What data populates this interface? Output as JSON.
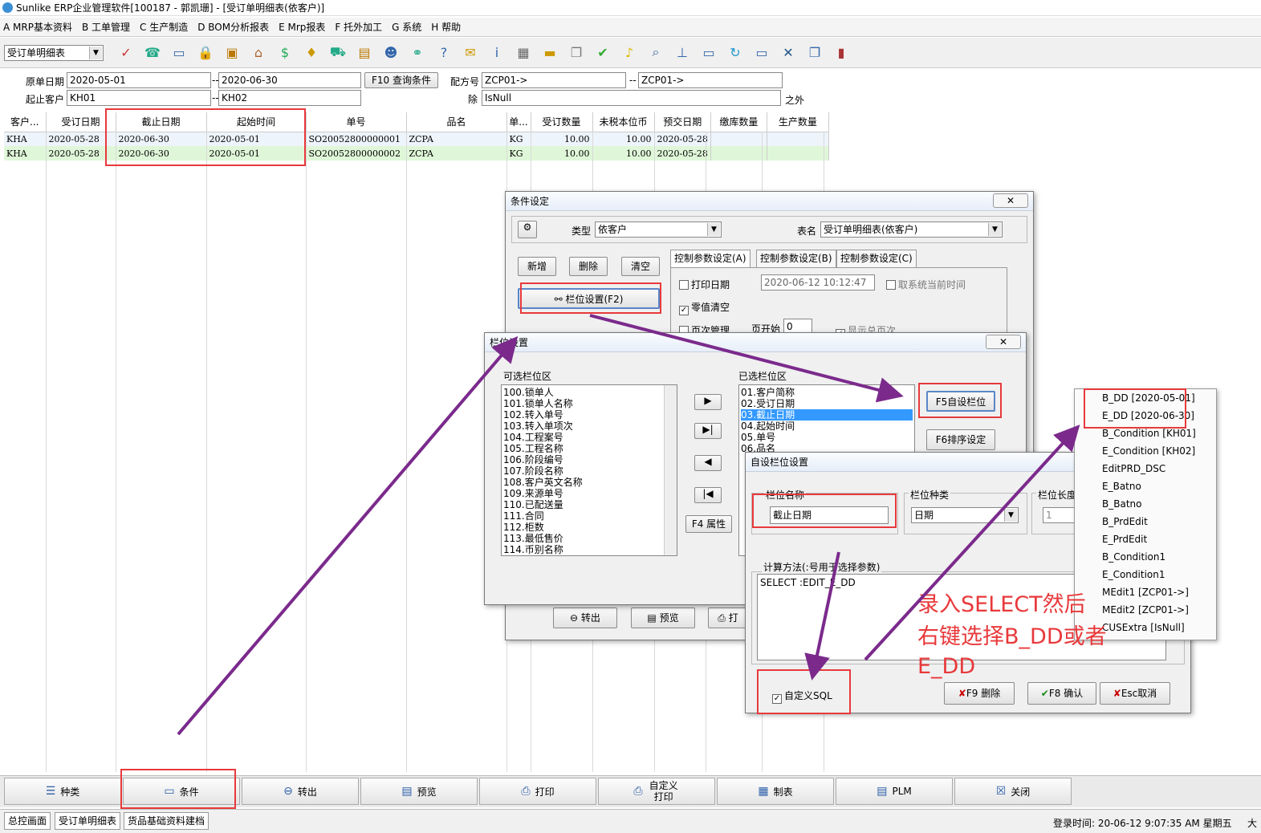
{
  "window": {
    "title": "Sunlike ERP企业管理软件[100187 - 郭凯珊] - [受订单明细表(依客户)]"
  },
  "menu": [
    "A MRP基本资料",
    "B 工单管理",
    "C 生产制造",
    "D BOM分析报表",
    "E Mrp报表",
    "F 托外加工",
    "G 系统",
    "H 帮助"
  ],
  "toolbar": {
    "report_select": "受订单明细表",
    "icons": [
      "spell-check-icon",
      "phone-icon",
      "monitor-icon",
      "lock-icon",
      "briefcase-icon",
      "house-icon",
      "dollar-icon",
      "money-bag-icon",
      "cart-icon",
      "clipboard-icon",
      "users-icon",
      "link-icon",
      "help-doc-icon",
      "mail-icon",
      "info-icon",
      "calculator-icon",
      "folder-icon",
      "copy-icon",
      "ok-icon",
      "bell-icon",
      "search-icon",
      "org-chart-icon",
      "screen-icon",
      "refresh-icon",
      "window-icon",
      "close-box-icon",
      "restore-icon",
      "exit-door-icon"
    ]
  },
  "filter": {
    "date_label": "原单日期",
    "date_from": "2020-05-01",
    "date_to": "2020-06-30",
    "query_button": "F10 查询条件",
    "formula_label": "配方号",
    "formula_from": "ZCP01->",
    "formula_to": "ZCP01->",
    "customer_label": "起止客户",
    "customer_from": "KH01",
    "customer_to": "KH02",
    "except_label": "除",
    "except_value": "IsNull",
    "except_suffix": "之外"
  },
  "grid": {
    "headers": [
      "客户...",
      "受订日期",
      "截止日期",
      "起始时间",
      "单号",
      "品名",
      "单...",
      "受订数量",
      "未税本位币",
      "预交日期",
      "缴库数量",
      "生产数量"
    ],
    "rows": [
      [
        "KHA",
        "2020-05-28",
        "2020-06-30",
        "2020-05-01",
        "SO20052800000001",
        "ZCPA",
        "KG",
        "10.00",
        "10.00",
        "2020-05-28",
        "",
        ""
      ],
      [
        "KHA",
        "2020-05-28",
        "2020-06-30",
        "2020-05-01",
        "SO20052800000002",
        "ZCPA",
        "KG",
        "10.00",
        "10.00",
        "2020-05-28",
        "",
        ""
      ]
    ]
  },
  "condition_dialog": {
    "title": "条件设定",
    "close": "✕",
    "type_label": "类型",
    "type_value": "依客户",
    "table_label": "表名",
    "table_value": "受订单明细表(依客户)",
    "add": "新增",
    "delete": "删除",
    "clear": "清空",
    "field_setting": "栏位设置(F2)",
    "tabs": [
      "控制参数设定(A)",
      "控制参数设定(B)",
      "控制参数设定(C)"
    ],
    "print_date_label": "打印日期",
    "print_date_value": "2020-06-12 10:12:47",
    "use_sys_time": "取系统当前时间",
    "zero_clear": "零值清空",
    "page_mgmt": "页次管理",
    "page_start_label": "页开始",
    "page_start_value": "0",
    "show_total_pages": "显示总页次",
    "export": "转出",
    "preview": "预览",
    "print_short": "打"
  },
  "field_dialog": {
    "title": "栏位设置",
    "close": "✕",
    "available_label": "可选栏位区",
    "available": [
      "100.锁单人",
      "101.锁单人名称",
      "102.转入单号",
      "103.转入单项次",
      "104.工程案号",
      "105.工程名称",
      "106.阶段编号",
      "107.阶段名称",
      "108.客户英文名称",
      "109.来源单号",
      "110.已配送量",
      "111.合同",
      "112.柜数",
      "113.最低售价",
      "114.币别名称"
    ],
    "selected_label": "已选栏位区",
    "selected": [
      "01.客户简称",
      "02.受订日期",
      "03.截止日期",
      "04.起始时间",
      "05.单号",
      "06.品名"
    ],
    "f5_button": "F5自设栏位",
    "f6_button": "F6排序设定",
    "f4_button": "F4 属性"
  },
  "custom_dialog": {
    "title": "自设栏位设置",
    "name_label": "栏位名称",
    "name_value": "截止日期",
    "kind_label": "栏位种类",
    "kind_value": "日期",
    "length_label": "栏位长度",
    "length_value": "1",
    "formula_label": "计算方法(:号用于选择参数)",
    "formula_value": "SELECT :EDIT_E_DD",
    "custom_sql": "自定义SQL",
    "delete_button": "F9 删除",
    "ok_button": "F8 确认",
    "cancel_button": "Esc取消"
  },
  "context_menu": [
    "B_DD [2020-05-01]",
    "E_DD [2020-06-30]",
    "B_Condition [KH01]",
    "E_Condition [KH02]",
    "EditPRD_DSC",
    "E_Batno",
    "B_Batno",
    "B_PrdEdit",
    "E_PrdEdit",
    "B_Condition1",
    "E_Condition1",
    "MEdit1 [ZCP01->]",
    "MEdit2 [ZCP01->]",
    "CUSExtra [IsNull]"
  ],
  "annotation": {
    "line1": "录入SELECT然后",
    "line2": "右键选择B_DD或者",
    "line3": "E_DD"
  },
  "bottom_buttons": [
    "种类",
    "条件",
    "转出",
    "预览",
    "打印",
    "自定义打印",
    "制表",
    "PLM",
    "关闭"
  ],
  "status": {
    "tabs": [
      "总控画面",
      "受订单明细表",
      "货品基础资料建档"
    ],
    "login": "登录时间:  20-06-12 9:07:35 AM  星期五",
    "edge": "大"
  },
  "colors": {
    "accent_red": "#e8393b",
    "arrow_purple": "#7b2a8c",
    "row1": "#eef4fb",
    "row2": "#dff7d8",
    "selected": "#3399ff"
  }
}
